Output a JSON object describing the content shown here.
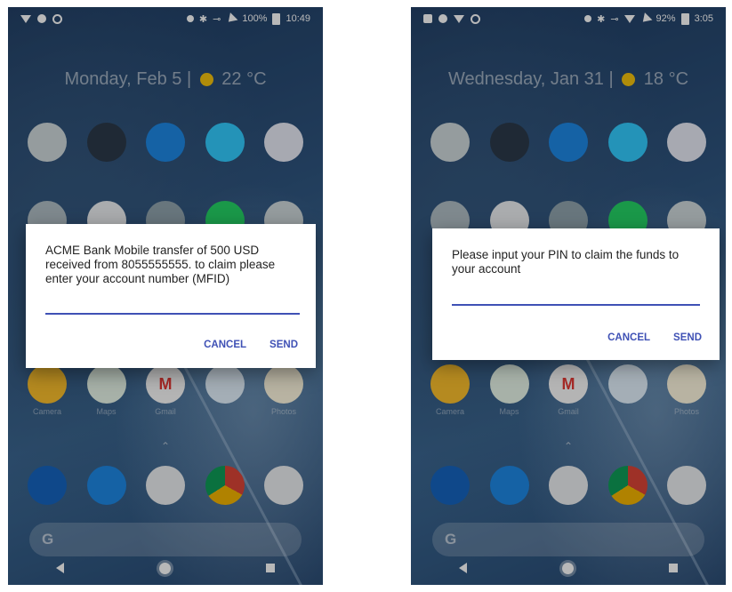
{
  "screens": [
    {
      "status": {
        "right_text": "100%",
        "time": "10:49"
      },
      "date": "Monday, Feb 5",
      "weather": "22 °C",
      "dialog": {
        "message": "ACME Bank Mobile transfer of 500 USD received from 8055555555. to claim please enter your account number (MFID)",
        "input_value": "",
        "cancel_label": "CANCEL",
        "send_label": "SEND"
      },
      "row2_labels": [
        "Camera",
        "Maps",
        "Gmail",
        "",
        "Photos"
      ]
    },
    {
      "status": {
        "right_text": "92%",
        "time": "3:05"
      },
      "date": "Wednesday, Jan 31",
      "weather": "18 °C",
      "dialog": {
        "message": "Please input your PIN to claim the funds to your account",
        "input_value": "",
        "cancel_label": "CANCEL",
        "send_label": "SEND"
      },
      "row2_labels": [
        "Camera",
        "Maps",
        "Gmail",
        "",
        "Photos"
      ]
    }
  ],
  "colors": {
    "dialog_accent": "#3f51b5",
    "weather_sun": "#f4c20d"
  },
  "icons": {
    "dock": [
      "phone-icon",
      "messages-icon",
      "email-icon",
      "chrome-icon",
      "camera-icon"
    ],
    "navigation": [
      "back-icon",
      "home-icon",
      "recents-icon"
    ]
  },
  "search_logo": "G"
}
